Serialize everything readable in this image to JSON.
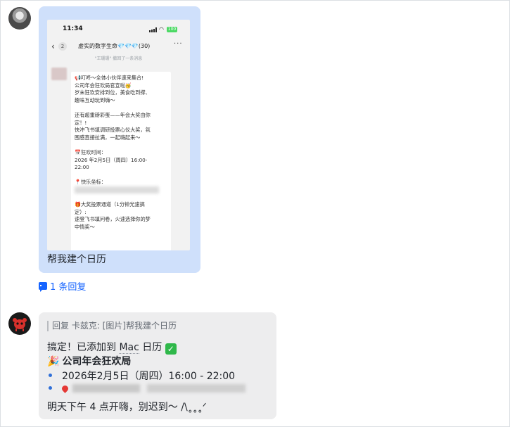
{
  "thread": {
    "user_message": {
      "caption": "帮我建个日历",
      "screenshot": {
        "status_time": "11:34",
        "battery": "100",
        "back_count": "2",
        "chat_title": "虚实的数字生命💎💎💎(30)",
        "system_note": "\"王珊珊\" 撤回了一条消息",
        "lines": [
          "📢叮咚～全体小伙伴速来集合!",
          "公司年会狂欢局官宣啦🥳",
          "岁末狂欢安排到位，美食吃到撑、",
          "趣味互动玩到嗨～",
          "",
          "还有超重磅彩蛋——年会大奖由你",
          "定！!",
          "快冲飞书填调研投票心仪大奖，氛",
          "围感直接拉满，一起嗨起来～",
          "",
          "📅狂欢时间：",
          "2026 年2月5日（周四）16:00-",
          "22:00",
          "",
          "📍快乐坐标：",
          "",
          "",
          "🎁大奖投票通道（1分钟光速搞",
          "定）:",
          "速登飞书填问卷，火速选择你的梦",
          "中情奖～"
        ]
      }
    },
    "reply_link": "1 条回复",
    "bot_message": {
      "quote": "回复 卡兹克: [图片]帮我建个日历",
      "line1_prefix": "搞定！已添加到 ",
      "line1_app": "Mac",
      "line1_suffix": " 日历 ",
      "title": "公司年会狂欢局",
      "date": "2026年2月5日（周四）16:00 - 22:00",
      "closing": "明天下午 4 点开嗨，别迟到～ /\\˳˳˳ᐟ"
    }
  },
  "colors": {
    "user_bubble": "#cfe0fb",
    "bot_bubble": "#ededee",
    "link": "#1664ff"
  },
  "icons": [
    "user-avatar",
    "bot-avatar",
    "reply-thread-icon",
    "check-mark-icon",
    "party-popper-icon",
    "location-pin-icon"
  ]
}
